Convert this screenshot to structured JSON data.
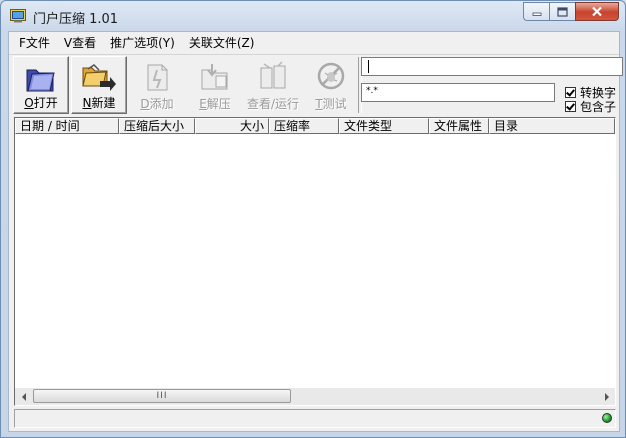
{
  "window": {
    "title": "门户压缩 1.01"
  },
  "menu": [
    "F文件",
    "V查看",
    "推广选项(Y)",
    "关联文件(Z)"
  ],
  "toolbar": {
    "open": {
      "key": "O",
      "text": "打开"
    },
    "new": {
      "key": "N",
      "text": "新建"
    },
    "add": {
      "key": "D",
      "text": "添加"
    },
    "extract": {
      "key": "E",
      "text": "解压"
    },
    "view": {
      "text": "查看/运行"
    },
    "test": {
      "key": "T",
      "text": "测试"
    }
  },
  "path_input": {
    "value": ""
  },
  "filter_input": {
    "value": "*.*"
  },
  "options": {
    "convert_label": "转换字",
    "convert_checked": true,
    "include_label": "包含子",
    "include_checked": true
  },
  "columns": [
    "日期 / 时间",
    "压缩后大小",
    "大小",
    "压缩率",
    "文件类型",
    "文件属性",
    "目录"
  ],
  "scrollbar": {
    "thumb_grip": "III"
  },
  "colors": {
    "status_led": "#1b9a2a",
    "close_button": "#c7432e"
  }
}
